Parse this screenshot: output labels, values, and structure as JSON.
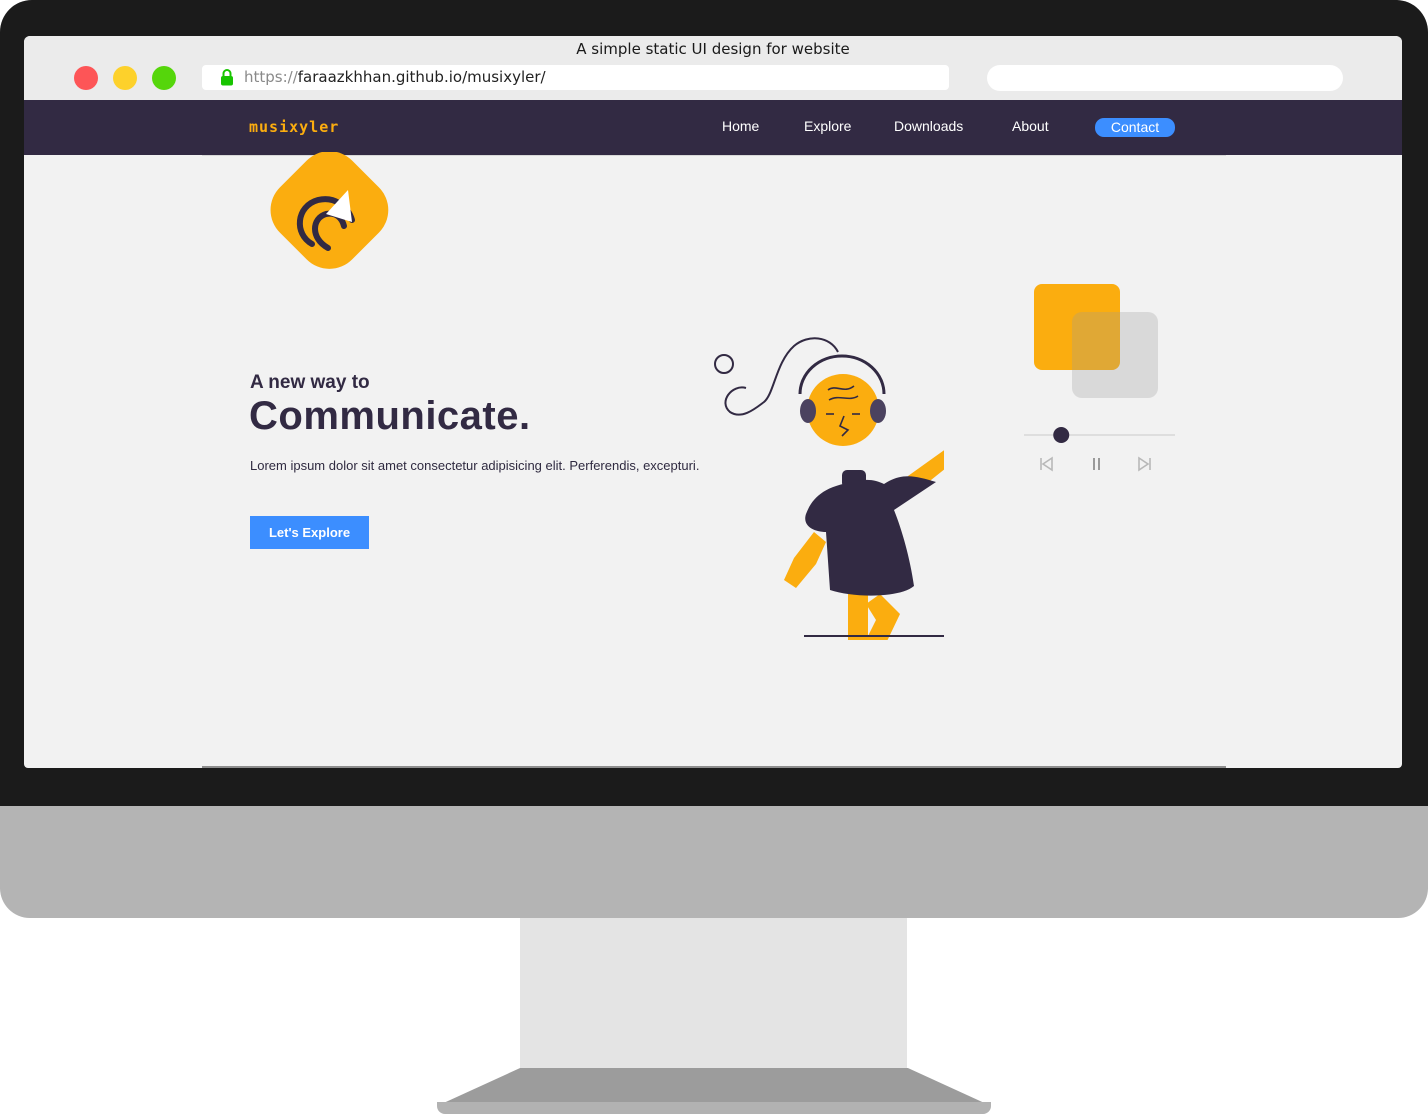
{
  "window": {
    "title": "A simple static UI design for website",
    "url_scheme": "https://",
    "url_rest": "faraazkhhan.github.io/musixyler/",
    "search_placeholder": ""
  },
  "site": {
    "brand": "musixyler",
    "nav": {
      "home": "Home",
      "explore": "Explore",
      "downloads": "Downloads",
      "about": "About",
      "contact": "Contact"
    },
    "hero": {
      "kicker": "A new way to",
      "title": "Communicate.",
      "body": "Lorem ipsum dolor sit amet consectetur adipisicing elit. Perferendis, excepturi.",
      "cta": "Let's Explore"
    },
    "player": {
      "progress": 0.28
    }
  },
  "colors": {
    "navbar": "#322a43",
    "accent": "#fbad0f",
    "primary_button": "#3c8eff",
    "screen_bg": "#f2f2f2"
  },
  "icons": [
    "lock-icon",
    "skip-back-icon",
    "pause-icon",
    "skip-forward-icon"
  ]
}
